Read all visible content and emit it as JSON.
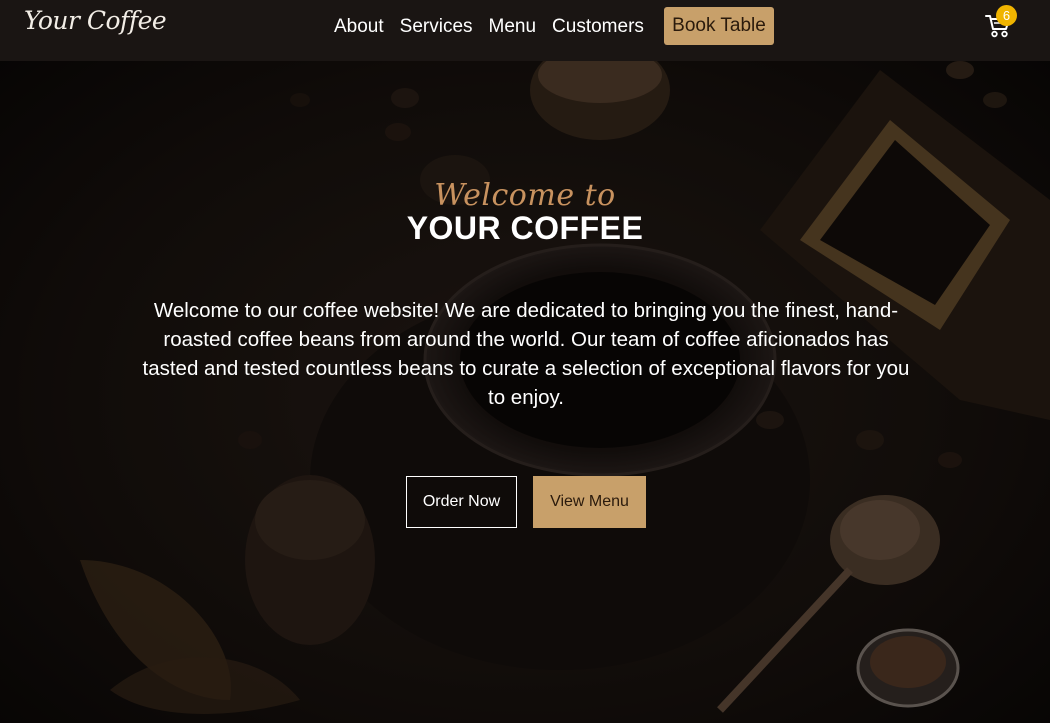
{
  "nav": {
    "logo": "Your Coffee",
    "links": [
      "About",
      "Services",
      "Menu",
      "Customers"
    ],
    "book_label": "Book Table",
    "cart_icon": "cart-icon",
    "cart_count": "6"
  },
  "hero": {
    "welcome": "Welcome to",
    "title": "YOUR COFFEE",
    "description": "Welcome to our coffee website! We are dedicated to bringing you the finest, hand-roasted coffee beans from around the world. Our team of coffee aficionados has tasted and tested countless beans to curate a selection of exceptional flavors for you to enjoy.",
    "order_label": "Order Now",
    "view_label": "View Menu"
  },
  "colors": {
    "accent": "#c8a06a",
    "badge": "#f0b400",
    "nav_bg": "#1a1513"
  }
}
